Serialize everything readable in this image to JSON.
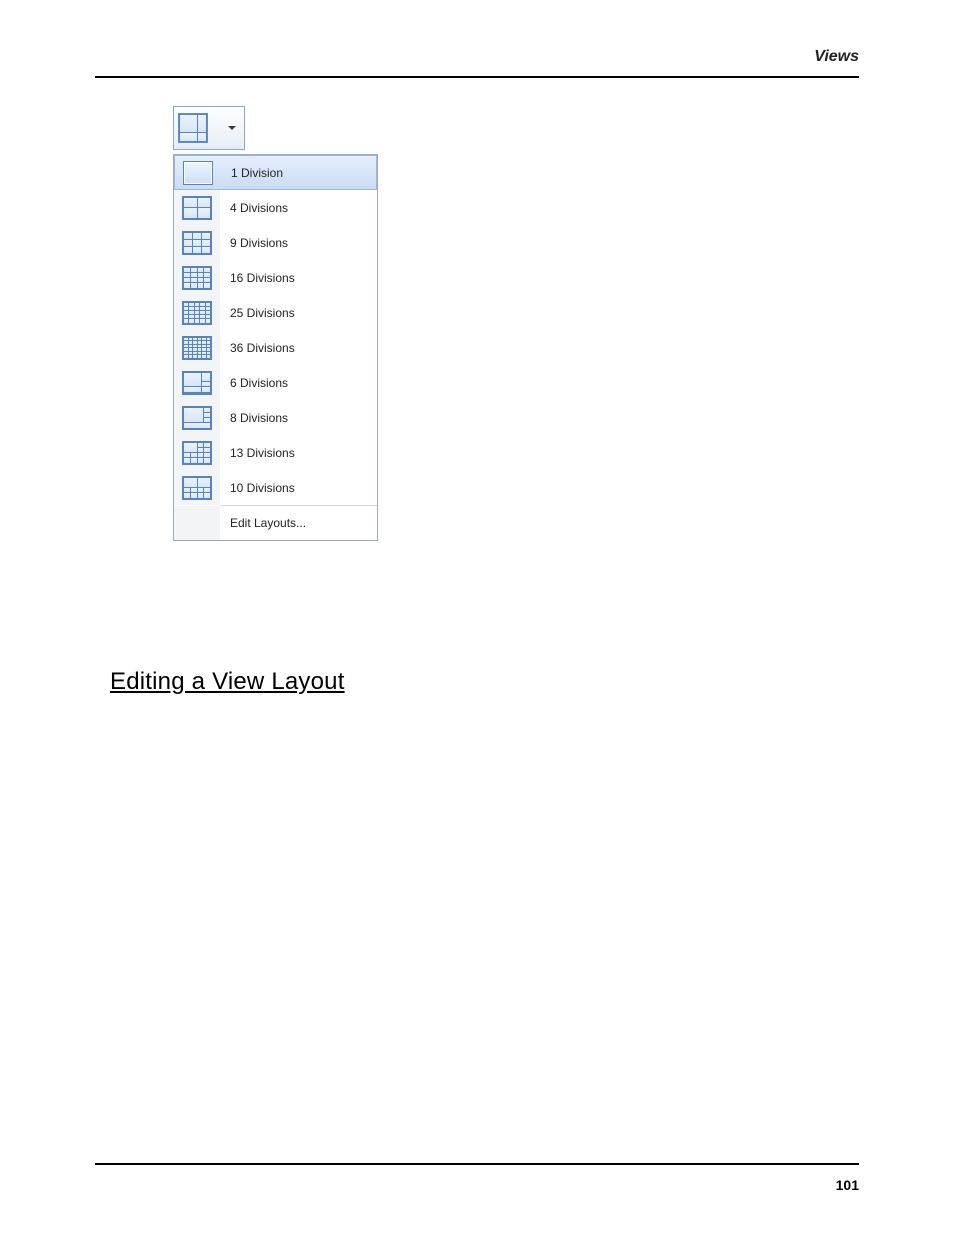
{
  "header": {
    "title": "Views"
  },
  "dropdown": {
    "items": [
      {
        "label": "1 Division",
        "grid": "1",
        "selected": true
      },
      {
        "label": "4 Divisions",
        "grid": "2x2"
      },
      {
        "label": "9 Divisions",
        "grid": "3x3"
      },
      {
        "label": "16 Divisions",
        "grid": "4x4"
      },
      {
        "label": "25 Divisions",
        "grid": "5x5"
      },
      {
        "label": "36 Divisions",
        "grid": "6x6"
      },
      {
        "label": "6 Divisions",
        "grid": "6"
      },
      {
        "label": "8 Divisions",
        "grid": "8"
      },
      {
        "label": "13 Divisions",
        "grid": "13"
      },
      {
        "label": "10 Divisions",
        "grid": "10"
      }
    ],
    "edit_label": "Edit Layouts..."
  },
  "section": {
    "heading": "Editing a View Layout"
  },
  "footer": {
    "page": "101"
  }
}
